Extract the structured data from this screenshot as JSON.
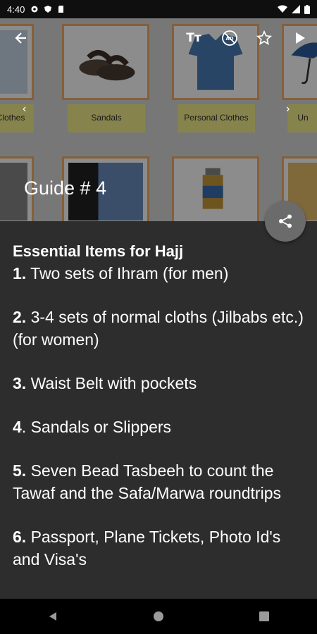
{
  "status_bar": {
    "time": "4:40"
  },
  "hero": {
    "title": "Guide # 4",
    "tiles": [
      {
        "label": "Clothes"
      },
      {
        "label": "Sandals"
      },
      {
        "label": "Personal Clothes"
      },
      {
        "label": "Un"
      }
    ],
    "toolbar": {
      "font_size_icon": "Tт",
      "ad_icon": "AD"
    }
  },
  "content": {
    "heading": "Essential Items for Hajj",
    "items": [
      {
        "num": "1.",
        "text": " Two sets of Ihram (for men)"
      },
      {
        "num": "2.",
        "text": " 3-4 sets of normal cloths (Jilbabs etc.) (for women)"
      },
      {
        "num": "3.",
        "text": " Waist Belt with pockets"
      },
      {
        "num": "4",
        "text": ". Sandals or Slippers"
      },
      {
        "num": "5.",
        "text": " Seven Bead Tasbeeh to count the Tawaf and the Safa/Marwa roundtrips"
      },
      {
        "num": "6.",
        "text": " Passport, Plane Tickets, Photo Id's and Visa's"
      }
    ]
  },
  "colors": {
    "content_bg": "#2d2d2d",
    "tile_border": "#f1b06a",
    "label_bg": "#f5f08a",
    "fab_bg": "#6b6b6b"
  }
}
